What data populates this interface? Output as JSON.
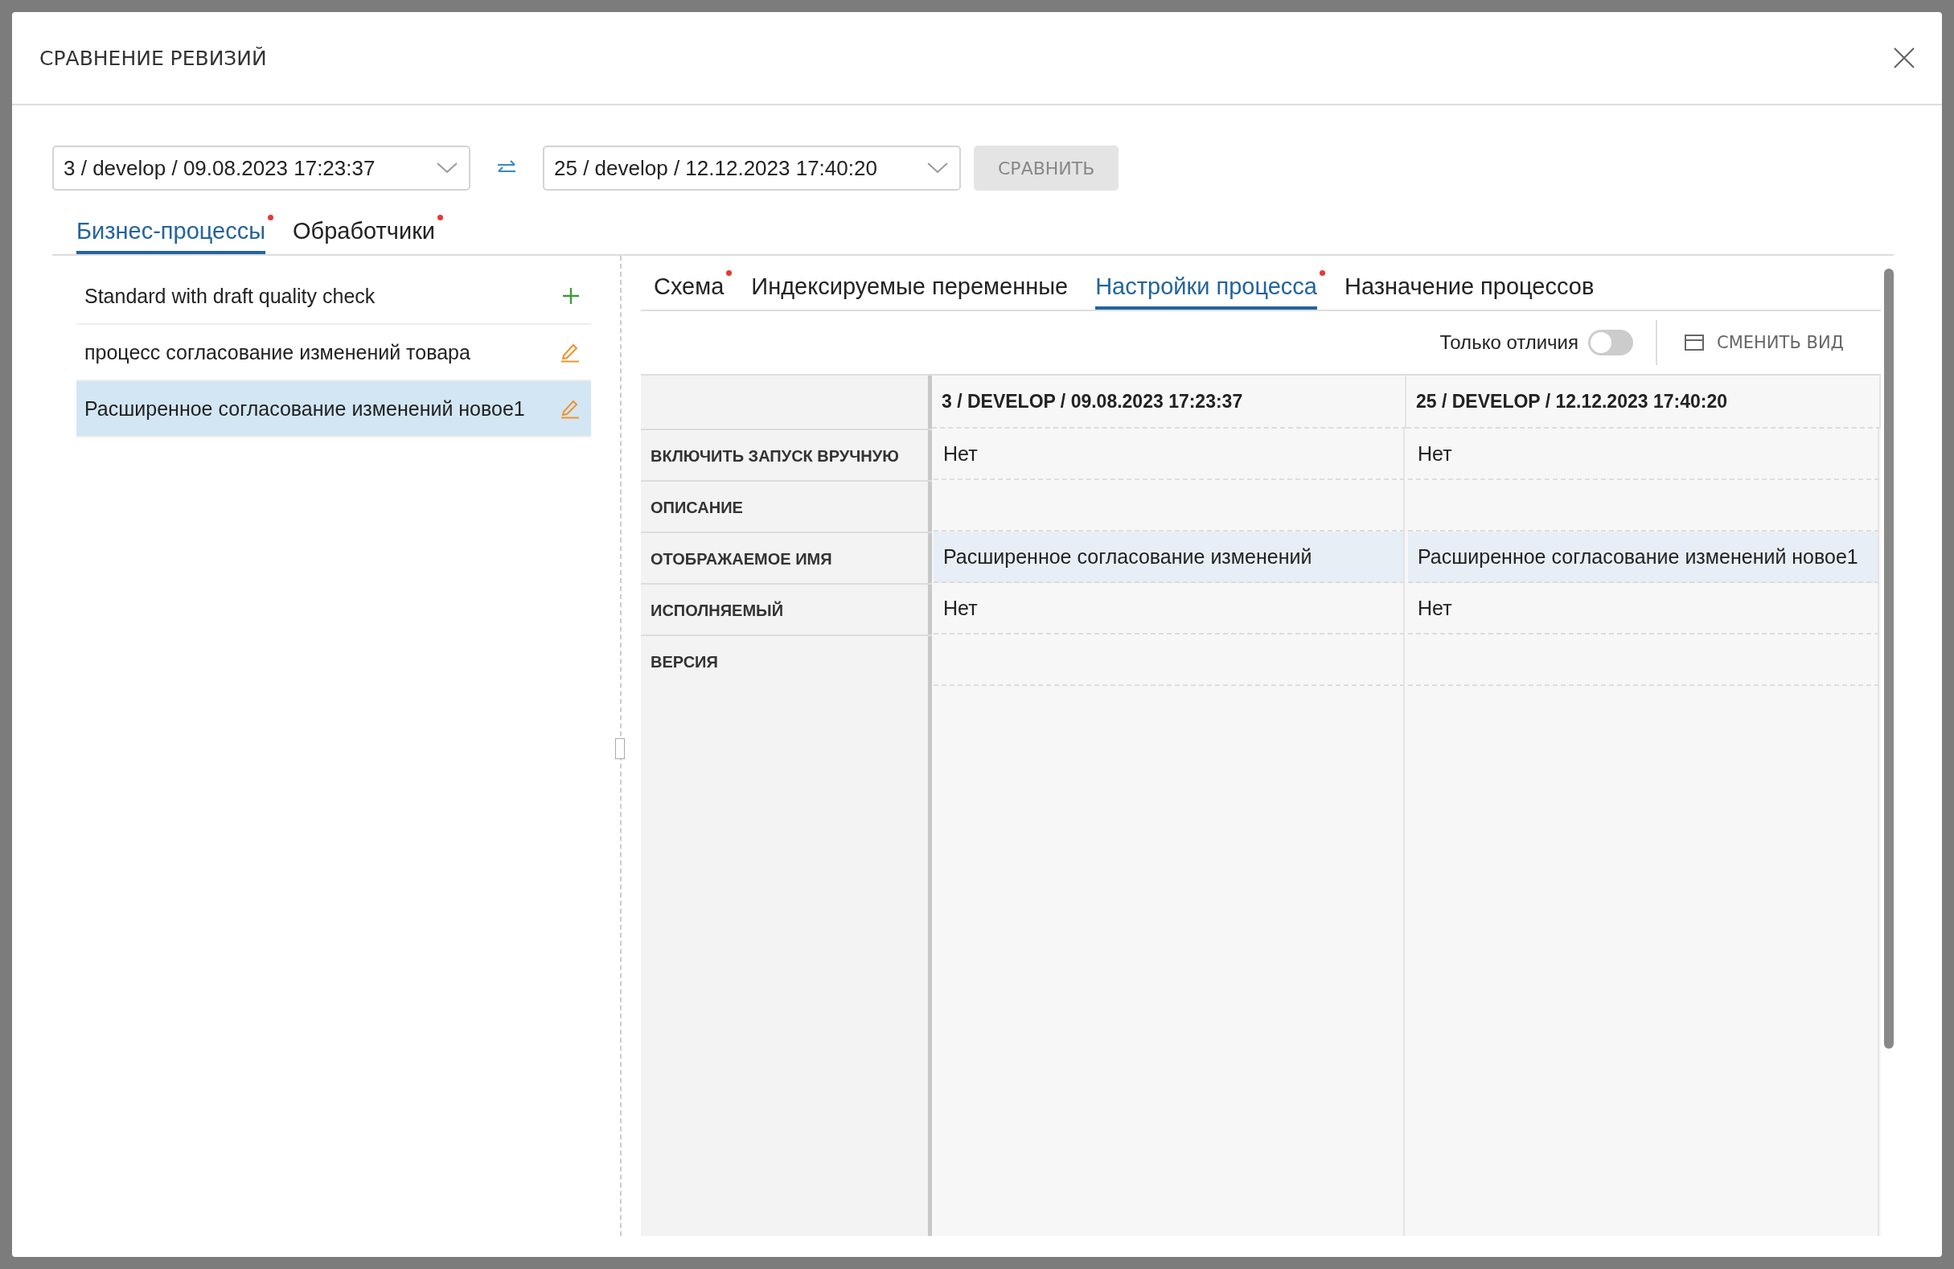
{
  "dialog": {
    "title": "СРАВНЕНИЕ РЕВИЗИЙ"
  },
  "revision_left": {
    "value": "3 / develop / 09.08.2023 17:23:37"
  },
  "revision_right": {
    "value": "25 / develop / 12.12.2023 17:40:20"
  },
  "compare_button": {
    "label": "СРАВНИТЬ",
    "disabled": true
  },
  "tabs": [
    {
      "label": "Бизнес-процессы",
      "selected": true,
      "changed": true
    },
    {
      "label": "Обработчики",
      "selected": false,
      "changed": true
    }
  ],
  "processes": [
    {
      "name": "Standard with draft quality check",
      "kind": "added",
      "selected": false
    },
    {
      "name": "процесс согласование изменений товара",
      "kind": "edited",
      "selected": false
    },
    {
      "name": "Расширенное согласование изменений новое1",
      "kind": "edited",
      "selected": true
    }
  ],
  "detail_tabs": [
    {
      "label": "Схема",
      "selected": false,
      "changed": true
    },
    {
      "label": "Индексируемые переменные",
      "selected": false,
      "changed": false
    },
    {
      "label": "Настройки процесса",
      "selected": true,
      "changed": true
    },
    {
      "label": "Назначение процессов",
      "selected": false,
      "changed": false
    }
  ],
  "toolbar": {
    "only_differences": {
      "label": "Только отличия",
      "on": false
    },
    "switch_view": "СМЕНИТЬ ВИД"
  },
  "table": {
    "columns": [
      "3 / DEVELOP / 09.08.2023 17:23:37",
      "25 / DEVELOP / 12.12.2023 17:40:20"
    ],
    "rows": [
      {
        "label": "ВКЛЮЧИТЬ ЗАПУСК ВРУЧНУЮ",
        "values": [
          "Нет",
          "Нет"
        ],
        "differs": false
      },
      {
        "label": "ОПИСАНИЕ",
        "values": [],
        "differs": false
      },
      {
        "label": "ОТОБРАЖАЕМОЕ ИМЯ",
        "values": [
          "Расширенное согласование изменений",
          "Расширенное согласование изменений новое1"
        ],
        "differs": true
      },
      {
        "label": "ИСПОЛНЯЕМЫЙ",
        "values": [
          "Нет",
          "Нет"
        ],
        "differs": false
      },
      {
        "label": "ВЕРСИЯ",
        "values": [],
        "differs": false
      }
    ]
  }
}
